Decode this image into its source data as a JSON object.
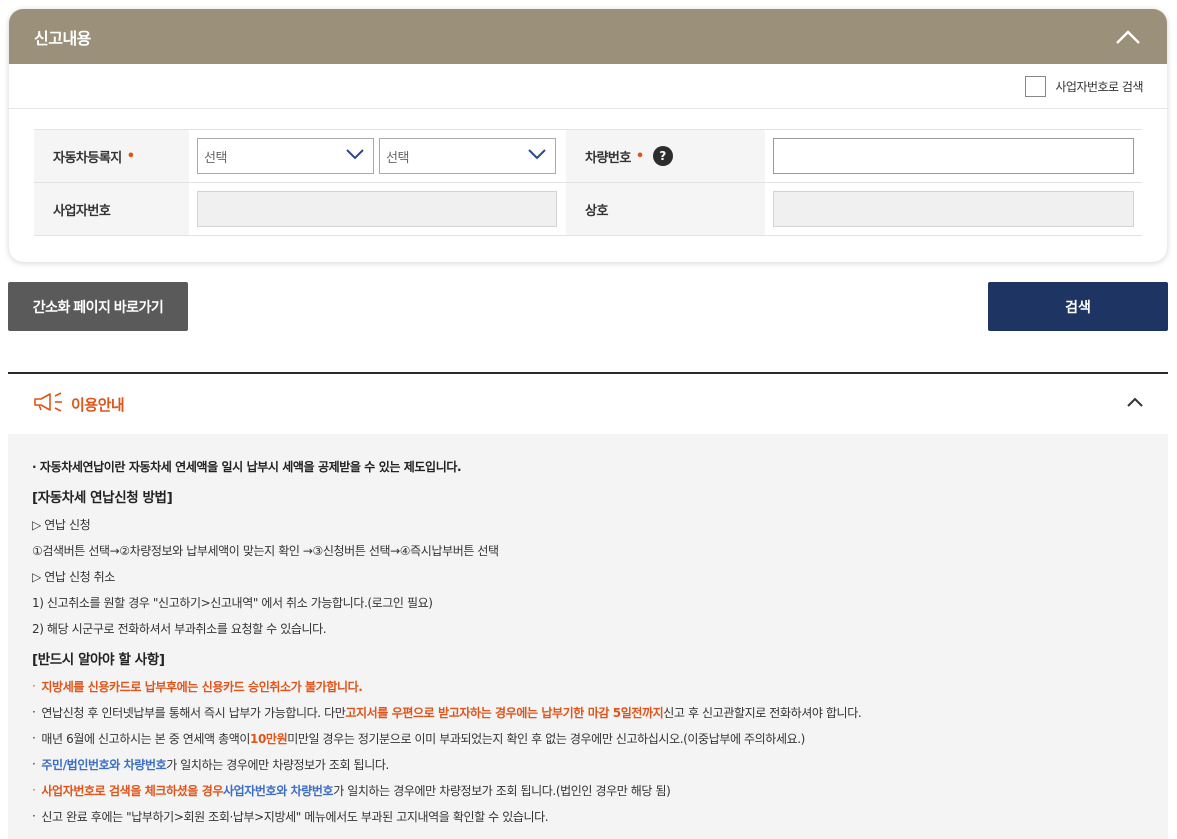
{
  "report": {
    "title": "신고내용",
    "biz_search_label": "사업자번호로 검색",
    "rows": {
      "car_registry_label": "자동차등록지",
      "required_mark": "•",
      "select1_value": "선택",
      "select2_value": "선택",
      "car_number_label": "차량번호",
      "help_glyph": "?",
      "biz_number_label": "사업자번호",
      "company_label": "상호"
    }
  },
  "buttons": {
    "shortcut_label": "간소화 페이지 바로가기",
    "search_label": "검색"
  },
  "guide": {
    "title": "이용안내",
    "intro": "· 자동차세연납이란 자동차세 연세액을 일시 납부시 세액을 공제받을 수 있는 제도입니다.",
    "section1_title": "[자동차세 연납신청 방법]",
    "s1_l1": "▷ 연납 신청",
    "s1_l2": "①검색버튼 선택→②차량정보와 납부세액이 맞는지 확인 →③신청버튼 선택→④즉시납부버튼 선택",
    "s1_l3": "▷ 연납 신청 취소",
    "s1_l4": "1) 신고취소를 원할 경우 \"신고하기>신고내역\" 에서 취소 가능합니다.(로그인 필요)",
    "s1_l5": "2) 해당 시군구로 전화하셔서 부과취소를 요청할 수 있습니다.",
    "section2_title": "[반드시 알아야 할 사항]",
    "bullet": "·",
    "s2_l1": "지방세를 신용카드로 납부후에는 신용카드 승인취소가 불가합니다.",
    "s2_l2_a": "연납신청 후 인터넷납부를 통해서 즉시 납부가 가능합니다. 다만 ",
    "s2_l2_b": "고지서를 우편으로 받고자하는 경우에는 납부기한 마감 5일전까지",
    "s2_l2_c": " 신고 후 신고관할지로 전화하셔야 합니다.",
    "s2_l3_a": "매년 6월에 신고하시는 본 중 연세액 총액이 ",
    "s2_l3_b": "10만원",
    "s2_l3_c": " 미만일 경우는 정기분으로 이미 부과되었는지 확인 후 없는 경우에만 신고하십시오.(이중납부에 주의하세요.)",
    "s2_l4_a": "주민/법인번호와 차량번호",
    "s2_l4_b": "가 일치하는 경우에만 차량정보가 조회 됩니다.",
    "s2_l5_a": "사업자번호로 검색을 체크하셨을 경우 ",
    "s2_l5_b": "사업자번호와 차량번호",
    "s2_l5_c": "가 일치하는 경우에만 차량정보가 조회 됩니다.(법인인 경우만 해당 됨)",
    "s2_l6": "신고 완료 후에는 \"납부하기>회원 조회·납부>지방세\" 메뉴에서도 부과된 고지내역을 확인할 수 있습니다."
  },
  "colors": {
    "header_bg": "#9b9079",
    "accent_orange": "#e0541a",
    "accent_blue": "#3c6ec4",
    "search_button": "#1e3462",
    "shortcut_button": "#5a5a5a"
  },
  "icons": [
    "chevron-up-icon",
    "chevron-down-icon",
    "help-icon",
    "megaphone-icon"
  ]
}
